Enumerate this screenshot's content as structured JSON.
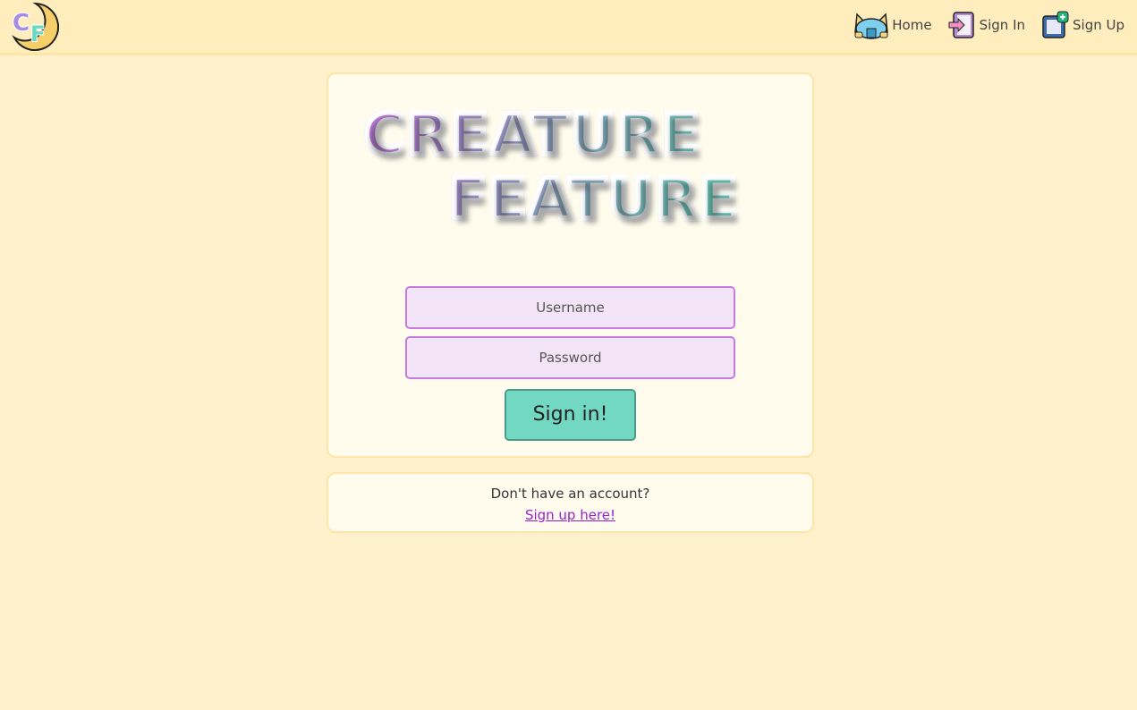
{
  "nav": {
    "logo_text": "CF",
    "links": [
      {
        "label": "Home",
        "icon": "cat-icon"
      },
      {
        "label": "Sign In",
        "icon": "sign-in-icon"
      },
      {
        "label": "Sign Up",
        "icon": "sign-up-icon"
      }
    ]
  },
  "main": {
    "title_line1": "CREATURE",
    "title_line2": "FEATURE",
    "username_placeholder": "Username",
    "password_placeholder": "Password",
    "submit_label": "Sign in!"
  },
  "footer": {
    "prompt": "Don't have an account?",
    "link": "Sign up here!"
  },
  "colors": {
    "background": "#fff1cc",
    "input_border": "#c57be2",
    "button": "#73d8c2",
    "link": "#9a1ed6"
  }
}
